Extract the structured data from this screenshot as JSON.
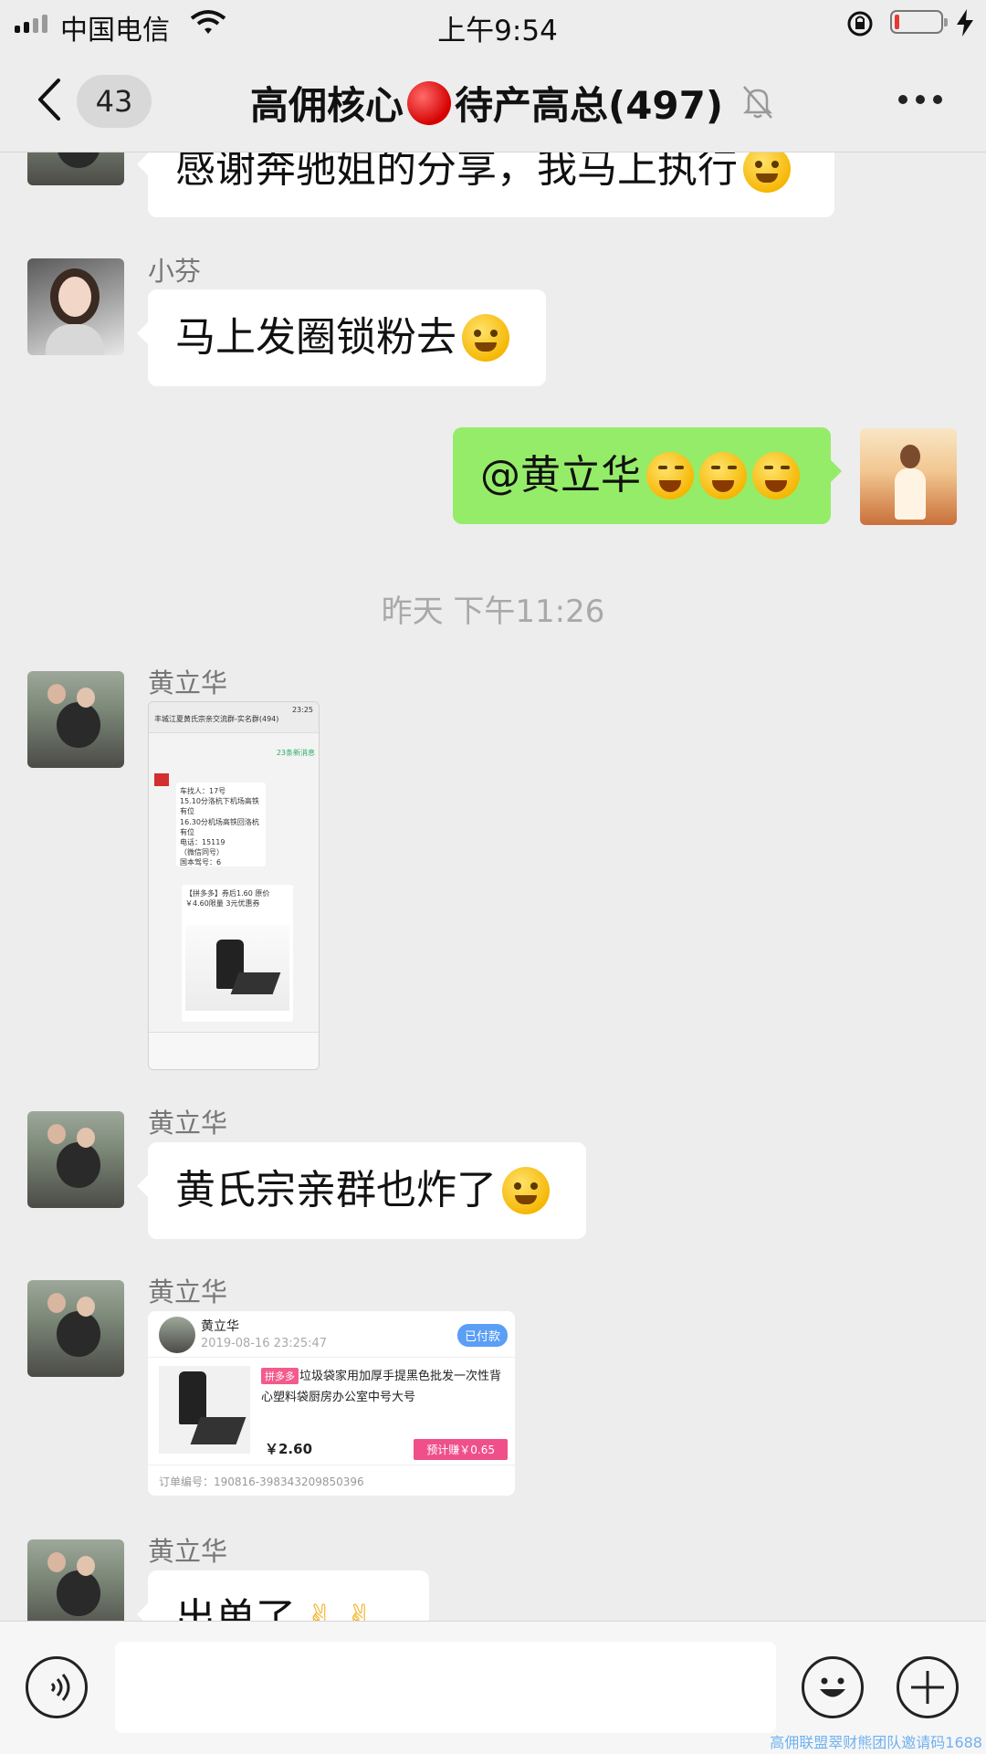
{
  "status_bar": {
    "carrier": "中国电信",
    "time": "上午9:54"
  },
  "nav": {
    "back_count": "43",
    "title_left": "高佣核心",
    "title_right": "待产高总(497)"
  },
  "messages": {
    "m1": {
      "text": "感谢奔驰姐的分享，我马上执行"
    },
    "m2": {
      "sender": "小芬",
      "text": "马上发圈锁粉去"
    },
    "m3": {
      "text": "@黄立华 "
    },
    "timestamp": "昨天 下午11:26",
    "m4": {
      "sender": "黄立华",
      "screenshot": {
        "title": "丰城江夏黄氏宗亲交流群-实名群(494)",
        "time": "23:25",
        "new_msgs": "23条新消息",
        "line1": "车找人：17号",
        "line2": "15.10分洛杭下机场高铁有位",
        "line3": "16.30分机场高铁回洛杭有位",
        "line4": "电话：15119",
        "line5": "（微信同号）",
        "line6": "国本驾号：6",
        "card_title": "【拼多多】券后1.60 原价",
        "card_sub": "￥4.60限量 3元优惠券"
      }
    },
    "m5": {
      "sender": "黄立华",
      "text": "黄氏宗亲群也炸了"
    },
    "m6": {
      "sender": "黄立华",
      "order": {
        "name": "黄立华",
        "time": "2019-08-16 23:25:47",
        "status": "已付款",
        "tag": "拼多多",
        "title": "垃圾袋家用加厚手提黑色批发一次性背心塑料袋厨房办公室中号大号",
        "price": "￥2.60",
        "earn": "预计赚￥0.65",
        "order_no": "订单编号：190816-398343209850396"
      }
    },
    "m7": {
      "sender": "黄立华",
      "text": "出单了"
    }
  },
  "watermark": "高佣联盟翠财熊团队邀请码1688",
  "colors": {
    "my_bubble": "#95ec69",
    "chat_bg": "#ededed",
    "paid_badge": "#5a9ef5",
    "earn_badge": "#f0508a"
  },
  "icons": [
    "back-chevron-icon",
    "mute-bell-icon",
    "more-dots-icon",
    "voice-icon",
    "emoji-icon",
    "plus-icon",
    "wifi-icon",
    "orientation-lock-icon",
    "charging-bolt-icon"
  ]
}
